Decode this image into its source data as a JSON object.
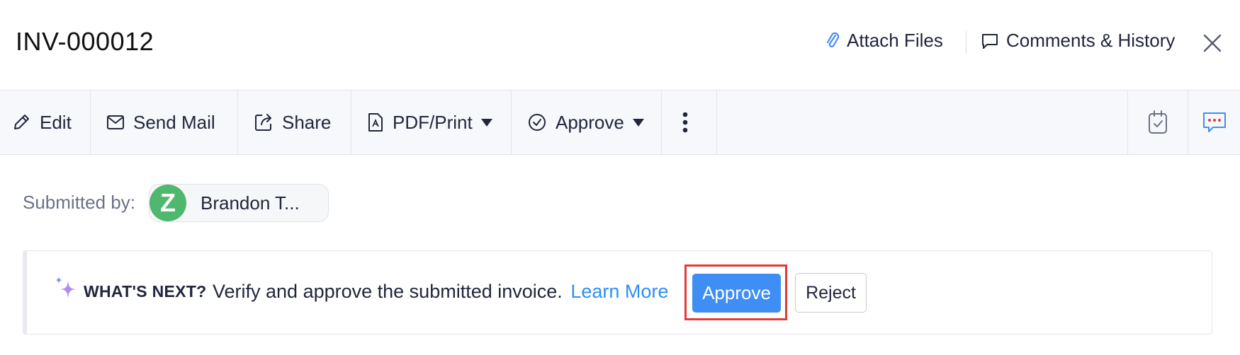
{
  "header": {
    "title": "INV-000012",
    "attach_label": "Attach Files",
    "comments_label": "Comments & History"
  },
  "toolbar": {
    "edit_label": "Edit",
    "send_mail_label": "Send Mail",
    "share_label": "Share",
    "pdf_print_label": "PDF/Print",
    "approve_label": "Approve"
  },
  "submitted": {
    "label": "Submitted by:",
    "avatar_initial": "Z",
    "user_name": "Brandon T..."
  },
  "whats_next": {
    "label": "WHAT'S NEXT?",
    "text": "Verify and approve the submitted invoice.",
    "link": "Learn More",
    "approve_button": "Approve",
    "reject_button": "Reject"
  },
  "colors": {
    "accent": "#3f8ef5",
    "link": "#2d8ff5",
    "avatar": "#4eb86f",
    "highlight": "#e33a3a"
  },
  "icons": [
    "paperclip-icon",
    "comment-icon",
    "close-icon",
    "pencil-icon",
    "mail-icon",
    "share-icon",
    "pdf-icon",
    "check-circle-icon",
    "more-vertical-icon",
    "calendar-check-icon",
    "chat-dots-icon",
    "sparkle-icon"
  ]
}
